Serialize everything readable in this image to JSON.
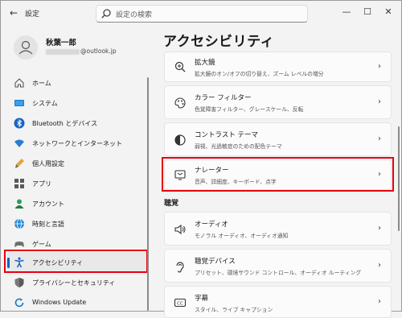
{
  "titlebar": {
    "back_icon": "back-arrow-icon",
    "app_title": "設定",
    "search_placeholder": "設定の検索",
    "minimize": "—",
    "maximize": "☐",
    "close": "✕"
  },
  "user": {
    "name": "秋葉一郎",
    "email_domain": "@outlook.jp"
  },
  "sidebar": {
    "items": [
      {
        "label": "ホーム",
        "icon": "home-icon"
      },
      {
        "label": "システム",
        "icon": "system-icon"
      },
      {
        "label": "Bluetooth とデバイス",
        "icon": "bluetooth-icon"
      },
      {
        "label": "ネットワークとインターネット",
        "icon": "wifi-icon"
      },
      {
        "label": "個人用設定",
        "icon": "brush-icon"
      },
      {
        "label": "アプリ",
        "icon": "apps-icon"
      },
      {
        "label": "アカウント",
        "icon": "account-icon"
      },
      {
        "label": "時刻と言語",
        "icon": "globe-clock-icon"
      },
      {
        "label": "ゲーム",
        "icon": "gamepad-icon"
      },
      {
        "label": "アクセシビリティ",
        "icon": "accessibility-icon",
        "selected": true
      },
      {
        "label": "プライバシーとセキュリティ",
        "icon": "shield-icon"
      },
      {
        "label": "Windows Update",
        "icon": "windows-update-icon"
      }
    ]
  },
  "main": {
    "title": "アクセシビリティ",
    "cards": [
      {
        "title": "拡大鏡",
        "desc": "拡大鏡のオン/オフの切り替え、ズーム レベルの増分",
        "icon": "magnifier-icon"
      },
      {
        "title": "カラー フィルター",
        "desc": "色覚障害フィルター、グレースケール、反転",
        "icon": "color-filter-icon"
      },
      {
        "title": "コントラスト テーマ",
        "desc": "弱視、光過敏症のための配色テーマ",
        "icon": "contrast-icon"
      },
      {
        "title": "ナレーター",
        "desc": "音声、詳細度、キーボード、点字",
        "icon": "narrator-icon"
      }
    ],
    "section_hearing": "聴覚",
    "hearing_cards": [
      {
        "title": "オーディオ",
        "desc": "モノラル オーディオ、オーディオ通知",
        "icon": "speaker-icon"
      },
      {
        "title": "聴覚デバイス",
        "desc": "プリセット、環境サウンド コントロール、オーディオ ルーティング",
        "icon": "hearing-device-icon"
      },
      {
        "title": "字幕",
        "desc": "スタイル、ライブ キャプション",
        "icon": "captions-icon"
      }
    ]
  },
  "colors": {
    "accent": "#0067c0",
    "highlight_box": "#e60012",
    "background": "#f3f3f3",
    "card": "#fbfbfb"
  }
}
